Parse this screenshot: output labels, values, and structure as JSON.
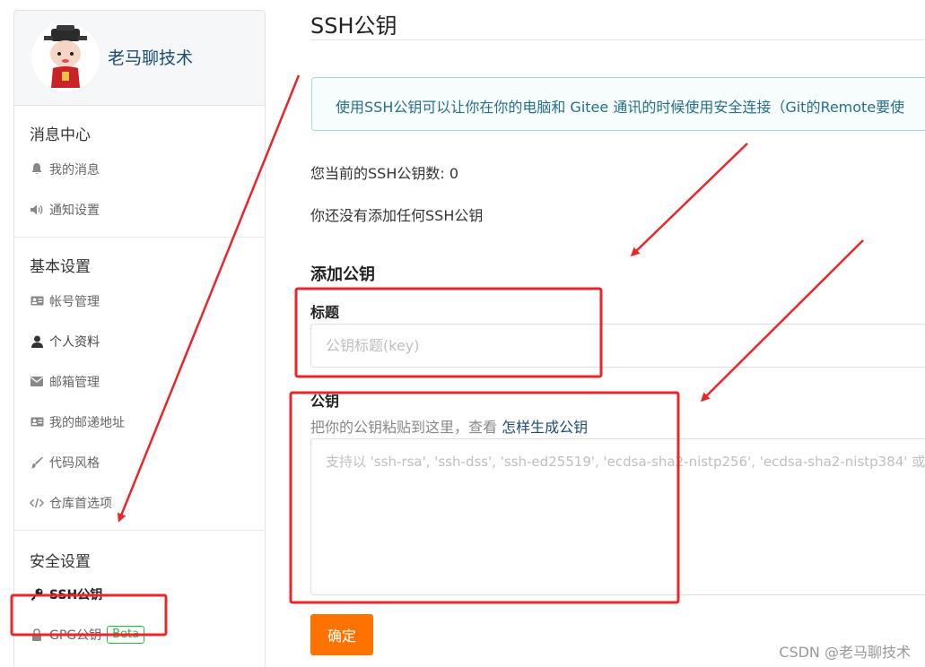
{
  "profile": {
    "username": "老马聊技术"
  },
  "sidebar": {
    "sections": [
      {
        "title": "消息中心",
        "items": [
          {
            "label": "我的消息",
            "icon": "bell-icon"
          },
          {
            "label": "通知设置",
            "icon": "volume-icon"
          }
        ]
      },
      {
        "title": "基本设置",
        "items": [
          {
            "label": "帐号管理",
            "icon": "id-card-icon"
          },
          {
            "label": "个人资料",
            "icon": "user-icon"
          },
          {
            "label": "邮箱管理",
            "icon": "envelope-icon"
          },
          {
            "label": "我的邮递地址",
            "icon": "address-card-icon"
          },
          {
            "label": "代码风格",
            "icon": "paint-brush-icon"
          },
          {
            "label": "仓库首选项",
            "icon": "code-icon"
          }
        ]
      },
      {
        "title": "安全设置",
        "items": [
          {
            "label": "SSH公钥",
            "icon": "key-icon",
            "active": true
          },
          {
            "label": "GPG公钥",
            "icon": "lock-icon",
            "badge": "Beta"
          }
        ]
      }
    ]
  },
  "main": {
    "page_title": "SSH公钥",
    "info": "使用SSH公钥可以让你在你的电脑和 Gitee 通讯的时候使用安全连接（Git的Remote要使",
    "count_text": "您当前的SSH公钥数: 0",
    "empty_text": "你还没有添加任何SSH公钥",
    "add_title": "添加公钥",
    "title_label": "标题",
    "title_placeholder": "公钥标题(key)",
    "key_label": "公钥",
    "hint_prefix": "把你的公钥粘贴到这里，查看 ",
    "hint_link": "怎样生成公钥",
    "key_placeholder": "支持以 'ssh-rsa', 'ssh-dss', 'ssh-ed25519', 'ecdsa-sha2-nistp256', 'ecdsa-sha2-nistp384' 或",
    "submit_label": "确定"
  },
  "watermark": "CSDN @老马聊技术",
  "colors": {
    "accent_orange": "#fe7300",
    "annotation_red": "#e8262b",
    "beta_green": "#21ba45",
    "link_blue": "#1d4b73"
  }
}
